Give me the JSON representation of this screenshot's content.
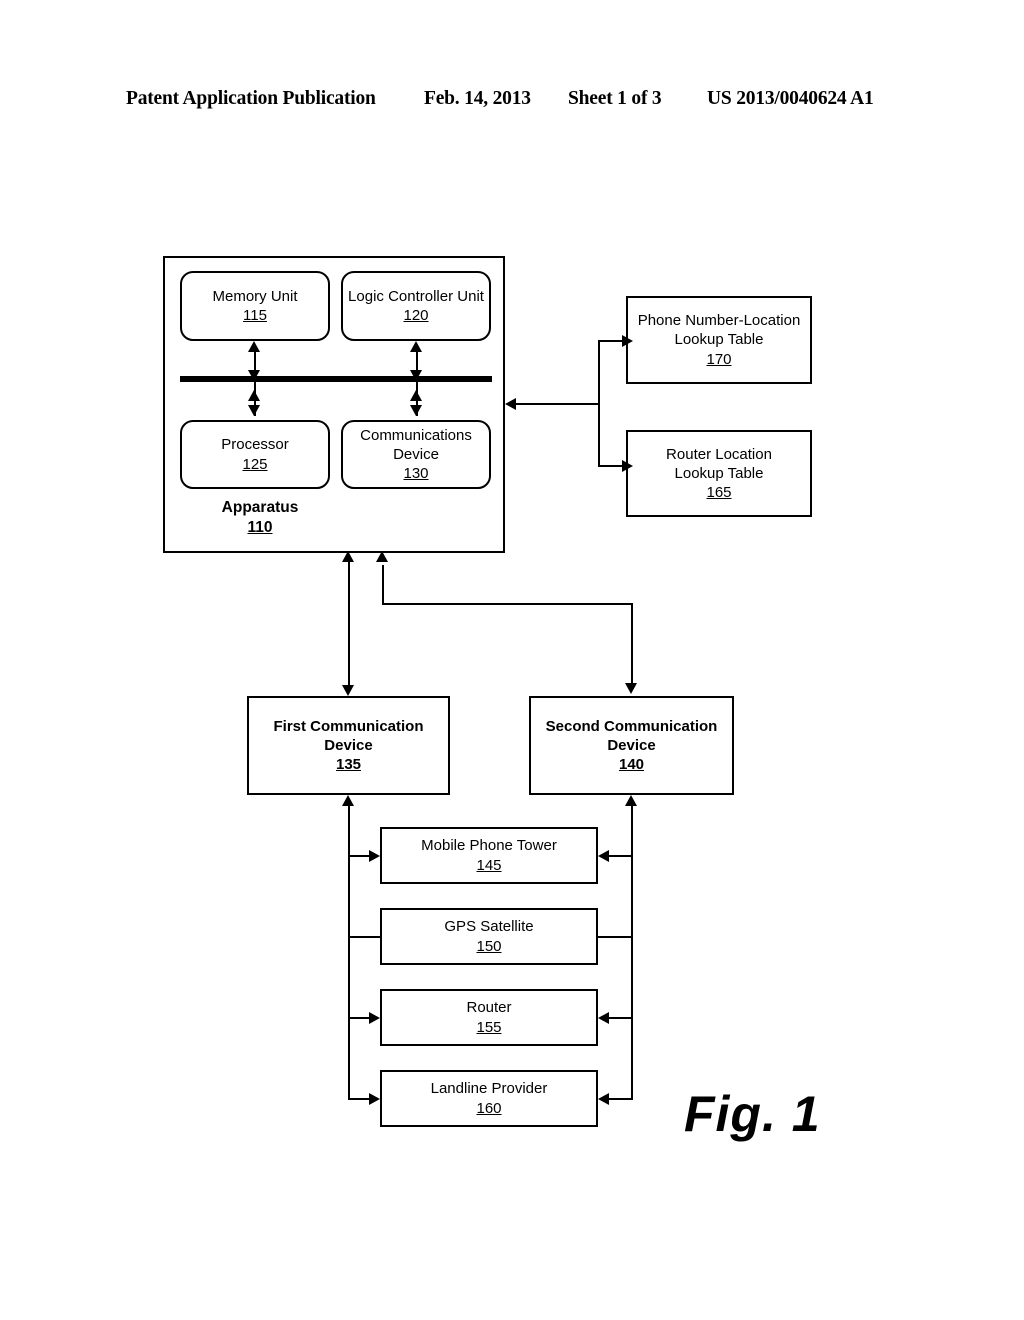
{
  "header": {
    "publication": "Patent Application Publication",
    "date": "Feb. 14, 2013",
    "sheet": "Sheet 1 of 3",
    "number": "US 2013/0040624 A1"
  },
  "figure": {
    "caption": "Fig. 1"
  },
  "apparatus": {
    "label": "Apparatus",
    "number": "110",
    "components": [
      {
        "title": "Memory Unit",
        "number": "115"
      },
      {
        "title": "Logic Controller Unit",
        "number": "120"
      },
      {
        "title": "Processor",
        "number": "125"
      },
      {
        "title": "Communications\nDevice",
        "number": "130"
      }
    ]
  },
  "lookup_tables": [
    {
      "title": "Phone Number-Location\nLookup Table",
      "number": "170"
    },
    {
      "title": "Router Location\nLookup Table",
      "number": "165"
    }
  ],
  "communication_devices": [
    {
      "title": "First Communication\nDevice",
      "number": "135"
    },
    {
      "title": "Second Communication\nDevice",
      "number": "140"
    }
  ],
  "network_elements": [
    {
      "title": "Mobile Phone Tower",
      "number": "145"
    },
    {
      "title": "GPS Satellite",
      "number": "150"
    },
    {
      "title": "Router",
      "number": "155"
    },
    {
      "title": "Landline Provider",
      "number": "160"
    }
  ],
  "colors": {
    "line": "#000000",
    "background": "#ffffff"
  }
}
